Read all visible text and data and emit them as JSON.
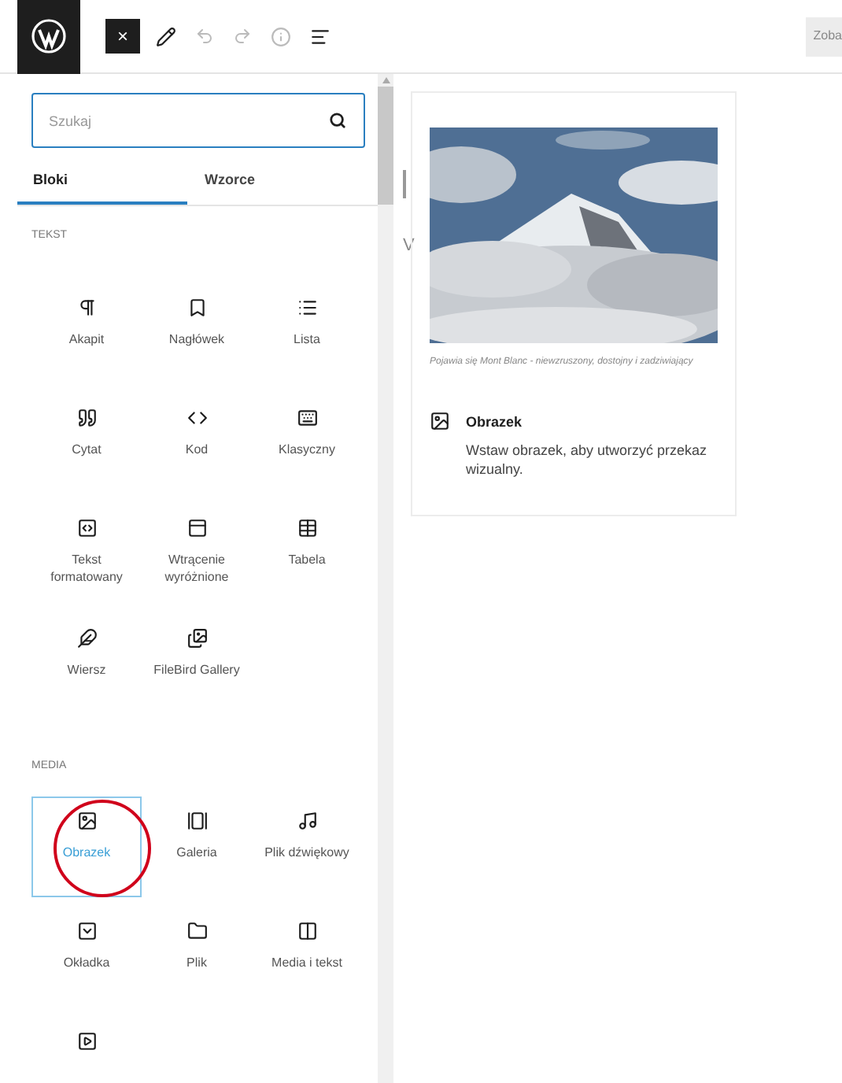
{
  "toolbar": {
    "close_label": "×",
    "preview_button": "Zoba"
  },
  "inserter": {
    "search": {
      "placeholder": "Szukaj"
    },
    "tabs": [
      {
        "label": "Bloki",
        "selected": true
      },
      {
        "label": "Wzorce",
        "selected": false
      }
    ],
    "sections": [
      {
        "title": "TEKST",
        "items": [
          {
            "label": "Akapit",
            "selected": false,
            "circled": false
          },
          {
            "label": "Nagłówek",
            "selected": false,
            "circled": false
          },
          {
            "label": "Lista",
            "selected": false,
            "circled": false
          },
          {
            "label": "Cytat",
            "selected": false,
            "circled": false
          },
          {
            "label": "Kod",
            "selected": false,
            "circled": false
          },
          {
            "label": "Klasyczny",
            "selected": false,
            "circled": false
          },
          {
            "label": "Tekst formatowany",
            "selected": false,
            "circled": false
          },
          {
            "label": "Wtrącenie wyróżnione",
            "selected": false,
            "circled": false
          },
          {
            "label": "Tabela",
            "selected": false,
            "circled": false
          },
          {
            "label": "Wiersz",
            "selected": false,
            "circled": false
          },
          {
            "label": "FileBird Gallery",
            "selected": false,
            "circled": false
          }
        ]
      },
      {
        "title": "MEDIA",
        "items": [
          {
            "label": "Obrazek",
            "selected": true,
            "circled": true
          },
          {
            "label": "Galeria",
            "selected": false,
            "circled": false
          },
          {
            "label": "Plik dźwiękowy",
            "selected": false,
            "circled": false
          },
          {
            "label": "Okładka",
            "selected": false,
            "circled": false
          },
          {
            "label": "Plik",
            "selected": false,
            "circled": false
          },
          {
            "label": "Media i tekst",
            "selected": false,
            "circled": false
          },
          {
            "selected": false,
            "circled": false
          }
        ]
      }
    ]
  },
  "canvas": {
    "edge_letter": "V"
  },
  "preview": {
    "kind": "picture",
    "caption": "Pojawia się Mont Blanc - niewzruszony, dostojny i zadziwiający",
    "title": "Obrazek",
    "description": "Wstaw obrazek, aby utworzyć przekaz wizualny."
  }
}
